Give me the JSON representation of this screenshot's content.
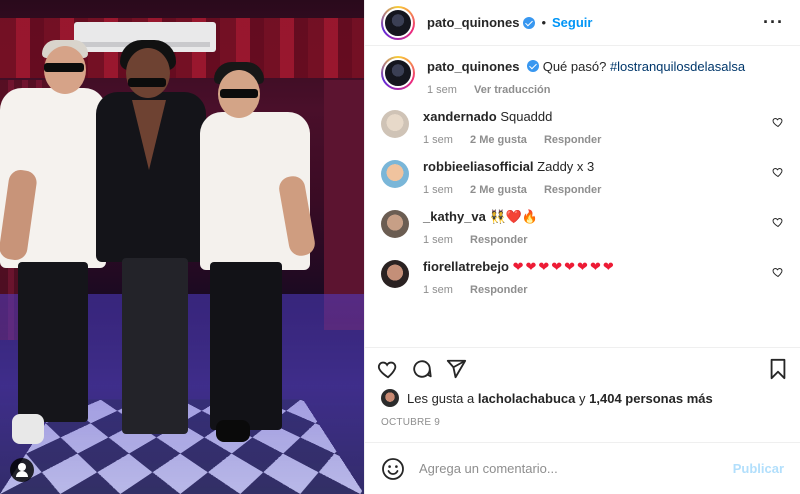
{
  "post": {
    "author": "pato_quinones",
    "follow_label": "Seguir",
    "dot": "•",
    "more_label": "···"
  },
  "caption": {
    "author": "pato_quinones",
    "text": "Qué pasó?",
    "hashtag": "#lostranquilosdelasalsa",
    "time": "1 sem",
    "translate": "Ver traducción"
  },
  "comments": [
    {
      "user": "xandernado",
      "text": "Squaddd",
      "time": "1 sem",
      "likes": "2 Me gusta",
      "reply": "Responder",
      "avatar_color": "#cfc3b6"
    },
    {
      "user": "robbieeliasofficial",
      "text": "Zaddy x 3",
      "time": "1 sem",
      "likes": "2 Me gusta",
      "reply": "Responder",
      "avatar_color": "#e9b28e"
    },
    {
      "user": "_kathy_va",
      "text": "👯❤️🔥",
      "time": "1 sem",
      "likes": "",
      "reply": "Responder",
      "avatar_color": "#8d7b6e"
    },
    {
      "user": "fiorellatrebejo",
      "text": "❤❤❤❤❤❤❤❤",
      "time": "1 sem",
      "likes": "",
      "reply": "Responder",
      "avatar_color": "#a26f5c"
    }
  ],
  "likes": {
    "prefix": "Les gusta a",
    "user": "lacholachabuca",
    "suffix": "y",
    "count": "1,404 personas más"
  },
  "date": "OCTUBRE 9",
  "composer": {
    "placeholder": "Agrega un comentario...",
    "publish": "Publicar"
  },
  "icons": [
    "heart-icon",
    "comment-icon",
    "share-icon",
    "bookmark-icon",
    "emoji-icon",
    "verified-badge-icon",
    "tag-user-icon"
  ]
}
